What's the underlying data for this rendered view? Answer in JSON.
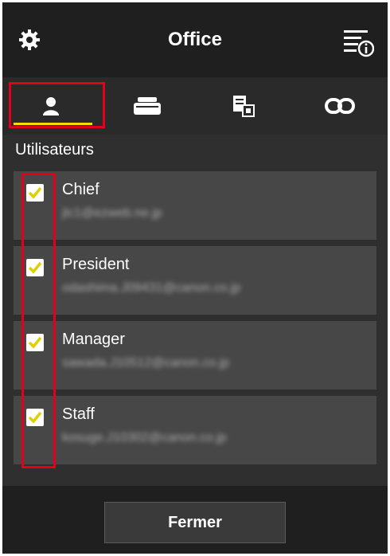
{
  "header": {
    "title": "Office",
    "settings_icon": "gear-icon",
    "menu_icon": "info-menu-icon"
  },
  "tabs": [
    {
      "icon": "user-icon",
      "selected": true
    },
    {
      "icon": "printer-icon",
      "selected": false
    },
    {
      "icon": "apps-icon",
      "selected": false
    },
    {
      "icon": "link-icon",
      "selected": false
    }
  ],
  "section": {
    "label": "Utilisateurs"
  },
  "users": [
    {
      "name": "Chief",
      "email": "jlc1@ezweb.ne.jp",
      "checked": true
    },
    {
      "name": "President",
      "email": "odashima.J09431@canon.co.jp",
      "checked": true
    },
    {
      "name": "Manager",
      "email": "sawada.J10512@canon.co.jp",
      "checked": true
    },
    {
      "name": "Staff",
      "email": "kosuge.J10302@canon.co.jp",
      "checked": true
    }
  ],
  "footer": {
    "close_label": "Fermer"
  },
  "colors": {
    "accent": "#f0e000",
    "highlight": "#e3001b",
    "background": "#2f2f2f",
    "card": "#474747"
  }
}
